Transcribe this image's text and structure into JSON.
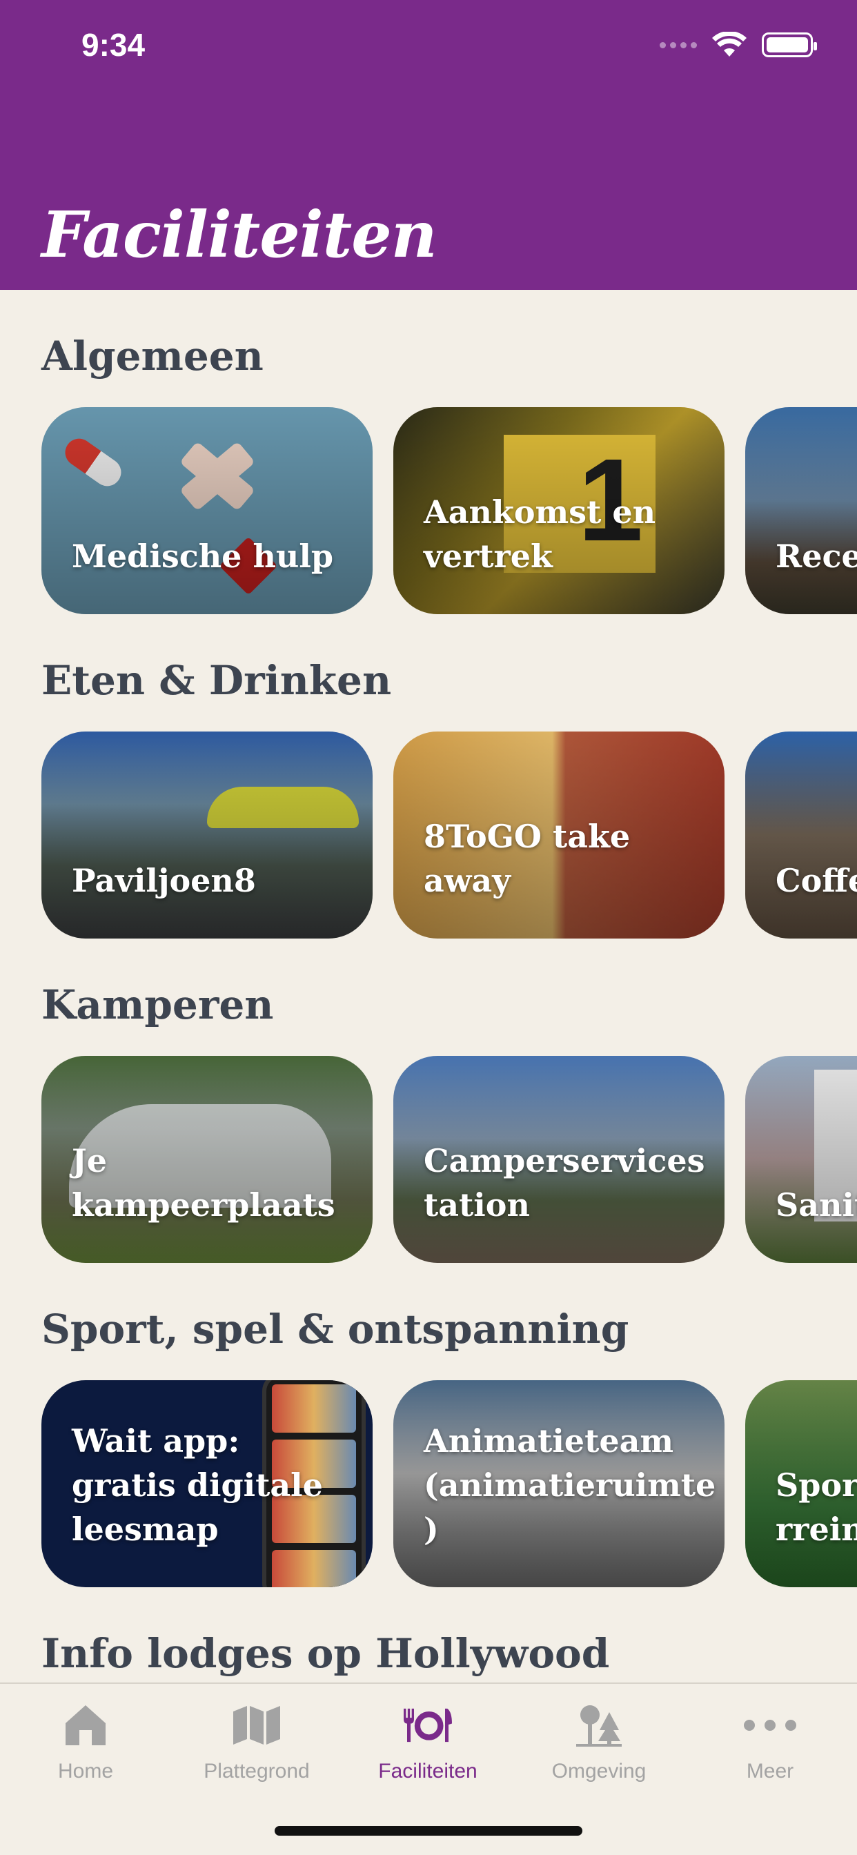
{
  "status": {
    "time": "9:34"
  },
  "header": {
    "title": "Faciliteiten"
  },
  "sections": [
    {
      "title": "Algemeen",
      "cards": [
        {
          "label": "Medische hulp"
        },
        {
          "label": "Aankomst en vertrek"
        },
        {
          "label": "Recep"
        }
      ]
    },
    {
      "title": "Eten & Drinken",
      "cards": [
        {
          "label": "Paviljoen8"
        },
        {
          "label": "8ToGO take away"
        },
        {
          "label": "Coffe"
        }
      ]
    },
    {
      "title": "Kamperen",
      "cards": [
        {
          "label": "Je kampeerplaats"
        },
        {
          "label": "Camperservices tation"
        },
        {
          "label": "Sanit wass"
        }
      ]
    },
    {
      "title": "Sport, spel & ontspanning",
      "cards": [
        {
          "label": "Wait app: gratis digitale leesmap"
        },
        {
          "label": "Animatieteam (animatieruimte )"
        },
        {
          "label": "Sport Even rrein"
        }
      ]
    },
    {
      "title": "Info lodges op Hollywood",
      "cards": []
    }
  ],
  "tabbar": {
    "tabs": [
      {
        "label": "Home",
        "icon": "home-icon"
      },
      {
        "label": "Plattegrond",
        "icon": "map-icon"
      },
      {
        "label": "Faciliteiten",
        "icon": "fork-plate-knife-icon",
        "active": true
      },
      {
        "label": "Omgeving",
        "icon": "trees-icon"
      },
      {
        "label": "Meer",
        "icon": "more-dots-icon"
      }
    ]
  },
  "colors": {
    "brand": "#7a2a8a",
    "background": "#f3efe7",
    "text": "#3d4450",
    "inactive": "#a3a3a3"
  }
}
